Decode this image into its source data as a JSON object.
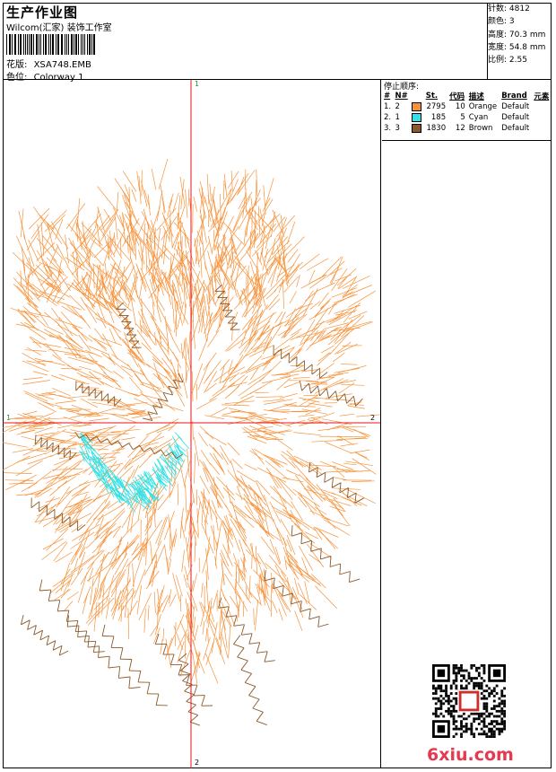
{
  "header": {
    "title": "生产作业图",
    "company": "Wilcom(汇家) 装饰工作室",
    "design_label": "花版:",
    "design_value": "XSA748.EMB",
    "colorway_label": "色位:",
    "colorway_value": "Colorway 1"
  },
  "stats": [
    {
      "label": "针数:",
      "value": "4812"
    },
    {
      "label": "颜色:",
      "value": "3"
    },
    {
      "label": "高度:",
      "value": "70.3 mm"
    },
    {
      "label": "宽度:",
      "value": "54.8 mm"
    },
    {
      "label": "比例:",
      "value": "2.55"
    }
  ],
  "stop_sequence": {
    "title": "停止顺序:",
    "headers": [
      "#",
      "N#",
      "St.",
      "代码",
      "描述",
      "Brand",
      "元素"
    ],
    "rows": [
      {
        "idx": "1.",
        "n": "2",
        "color": "#f7923a",
        "st": "2795",
        "code": "10",
        "desc": "Orange",
        "brand": "Default"
      },
      {
        "idx": "2.",
        "n": "1",
        "color": "#2fe3e8",
        "st": "185",
        "code": "5",
        "desc": "Cyan",
        "brand": "Default"
      },
      {
        "idx": "3.",
        "n": "3",
        "color": "#8a5a2b",
        "st": "1830",
        "code": "12",
        "desc": "Brown",
        "brand": "Default"
      }
    ]
  },
  "axes": {
    "top": "1",
    "bottom": "2",
    "left": "1",
    "right": "2"
  },
  "watermark": {
    "site": "6xiu.com",
    "seal": "以思"
  },
  "colors": {
    "orange": "#f7923a",
    "cyan": "#2fe3e8",
    "brown": "#8a5a2b",
    "axis": "#e8121b"
  }
}
